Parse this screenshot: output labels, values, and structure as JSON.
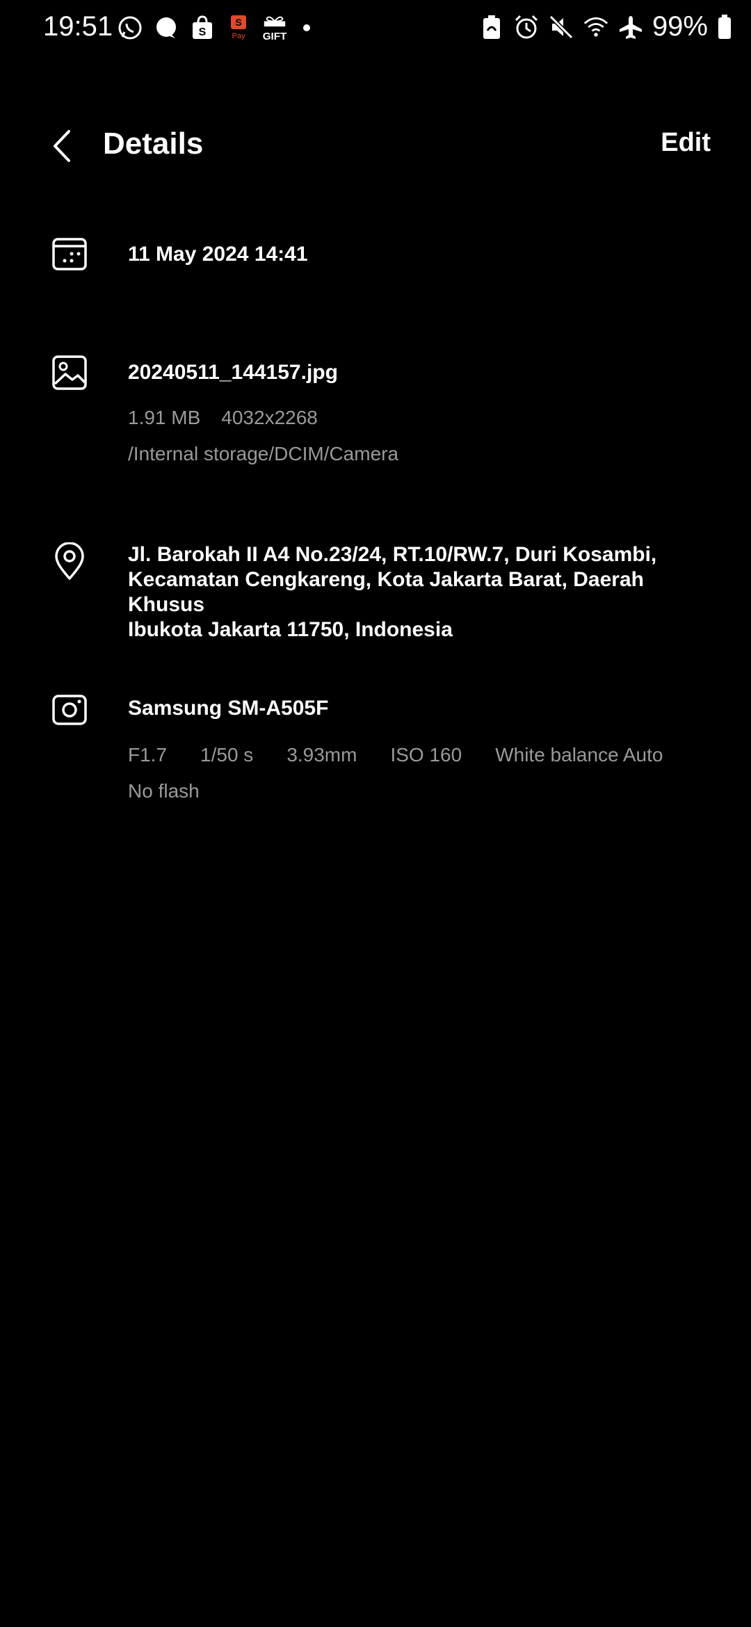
{
  "status_bar": {
    "time": "19:51",
    "battery_percent": "99%",
    "icons_left": [
      "whatsapp-icon",
      "chat-bubble-icon",
      "shop-bag-icon",
      "pay-icon",
      "gift-icon",
      "dot-icon"
    ],
    "icons_right": [
      "battery-saver-icon",
      "alarm-icon",
      "mute-icon",
      "wifi-icon",
      "airplane-icon",
      "battery-icon"
    ],
    "pay_text": "Pay",
    "gift_text": "GIFT"
  },
  "header": {
    "title": "Details",
    "edit_label": "Edit"
  },
  "date_section": {
    "datetime": "11 May 2024 14:41"
  },
  "file_section": {
    "filename": "20240511_144157.jpg",
    "size": "1.91 MB",
    "resolution": "4032x2268",
    "path": "/Internal storage/DCIM/Camera"
  },
  "location_section": {
    "address_line1": "Jl. Barokah II A4 No.23/24, RT.10/RW.7, Duri Kosambi,",
    "address_line2": "Kecamatan Cengkareng, Kota Jakarta Barat, Daerah Khusus",
    "address_line3": "Ibukota Jakarta 11750, Indonesia"
  },
  "camera_section": {
    "model": "Samsung SM-A505F",
    "aperture": "F1.7",
    "shutter": "1/50 s",
    "focal_length": "3.93mm",
    "iso": "ISO 160",
    "white_balance": "White balance Auto",
    "flash": "No flash"
  }
}
